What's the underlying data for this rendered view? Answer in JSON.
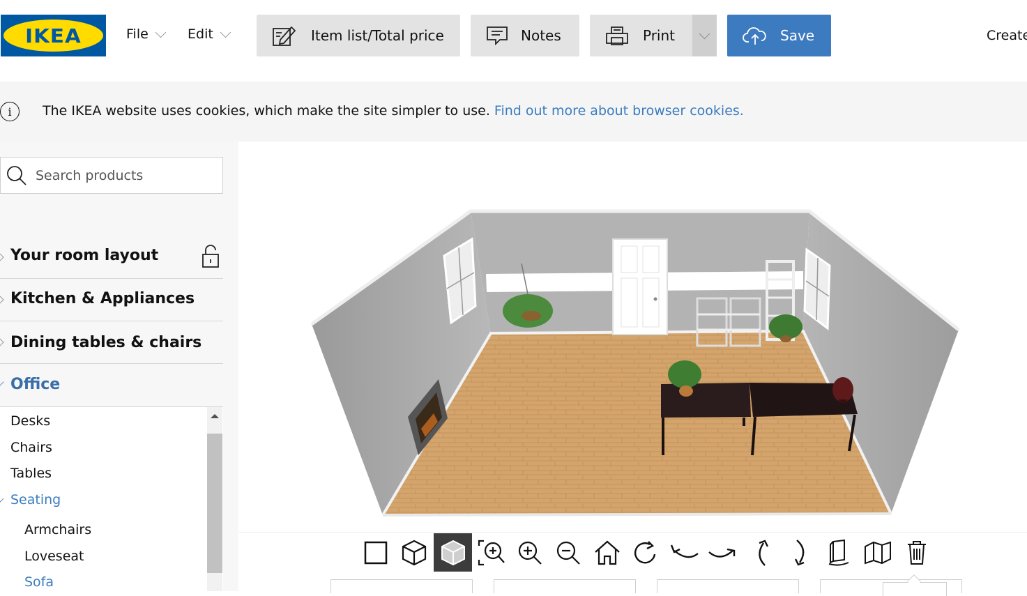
{
  "brand": {
    "logo_text": "IKEA",
    "primary": "#0058a3",
    "secondary": "#ffdb00"
  },
  "menu": {
    "file": "File",
    "edit": "Edit"
  },
  "toolbar": {
    "item_list": "Item list/Total price",
    "notes": "Notes",
    "print": "Print",
    "save": "Save",
    "create": "Create"
  },
  "cookie": {
    "text": "The IKEA website uses cookies, which make the site simpler to use.",
    "link": "Find out more about browser cookies."
  },
  "sidebar": {
    "search_placeholder": "Search products",
    "categories": [
      {
        "label": "Your room layout"
      },
      {
        "label": "Kitchen & Appliances"
      },
      {
        "label": "Dining tables & chairs"
      },
      {
        "label": "Office",
        "expanded": true
      }
    ],
    "subitems": [
      "Desks",
      "Chairs",
      "Tables",
      "Seating"
    ],
    "seating_items": [
      "Armchairs",
      "Loveseat",
      "Sofa"
    ]
  },
  "view_tools": [
    "2d-view-icon",
    "3d-view-icon",
    "3d-solid-view-icon",
    "zoom-fit-icon",
    "zoom-in-icon",
    "zoom-out-icon",
    "home-view-icon",
    "rotate-right-icon",
    "rotate-left-icon",
    "rotate-right-alt-icon",
    "tilt-up-icon",
    "tilt-down-icon",
    "wall-view-icon",
    "walls-view-icon",
    "trash-icon"
  ]
}
